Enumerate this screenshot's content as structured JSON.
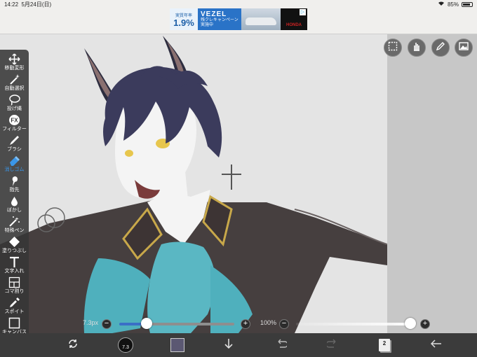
{
  "status_bar": {
    "time": "14:22",
    "date": "5月24日(日)",
    "battery": "85%"
  },
  "ad": {
    "rate_caption": "実質年率",
    "rate": "1.9%",
    "model": "VEZEL",
    "line1": "残クレキャンペーン",
    "line2": "実施中",
    "brand": "HONDA",
    "choices_icon": "adchoices-icon"
  },
  "toolbar": {
    "tools": [
      {
        "label": "移動変形",
        "icon": "move-icon"
      },
      {
        "label": "自動選択",
        "icon": "magic-wand-icon"
      },
      {
        "label": "投げ縄",
        "icon": "lasso-icon"
      },
      {
        "label": "フィルター",
        "icon": "fx-icon"
      },
      {
        "label": "ブラシ",
        "icon": "brush-icon"
      },
      {
        "label": "消しゴム",
        "icon": "eraser-icon",
        "active": true
      },
      {
        "label": "指先",
        "icon": "finger-icon"
      },
      {
        "label": "ぼかし",
        "icon": "blur-drop-icon"
      },
      {
        "label": "特殊ペン",
        "icon": "special-pen-icon"
      },
      {
        "label": "塗りつぶし",
        "icon": "fill-icon"
      },
      {
        "label": "文字入れ",
        "icon": "text-icon"
      },
      {
        "label": "コマ割り",
        "icon": "frame-divide-icon"
      },
      {
        "label": "スポイト",
        "icon": "eyedropper-icon"
      },
      {
        "label": "キャンバス",
        "icon": "canvas-icon"
      }
    ]
  },
  "canvas_buttons": [
    "selection-icon",
    "hand-icon",
    "pencil-icon",
    "image-icon"
  ],
  "sliders": {
    "size": {
      "label": "7.3px",
      "minus": "−",
      "plus": "+",
      "level": 0.25
    },
    "opacity": {
      "label": "100%",
      "minus": "−",
      "plus": "+",
      "level": 1.0
    }
  },
  "bottom_bar": {
    "brush_size": "7.3",
    "color": "#5b5872",
    "layer_count": "2",
    "icons": [
      "transform-icon",
      "brush-size-icon",
      "color-swatch",
      "download-icon",
      "undo-icon",
      "redo-icon",
      "layers-icon",
      "back-icon"
    ]
  },
  "colors": {
    "toolbar_bg": "#373737",
    "active_tool": "#3a96e8",
    "canvas_bg": "#e4e4e4",
    "workspace_bg": "#c7c7c7",
    "bottom_bar": "#3b3b3b"
  }
}
